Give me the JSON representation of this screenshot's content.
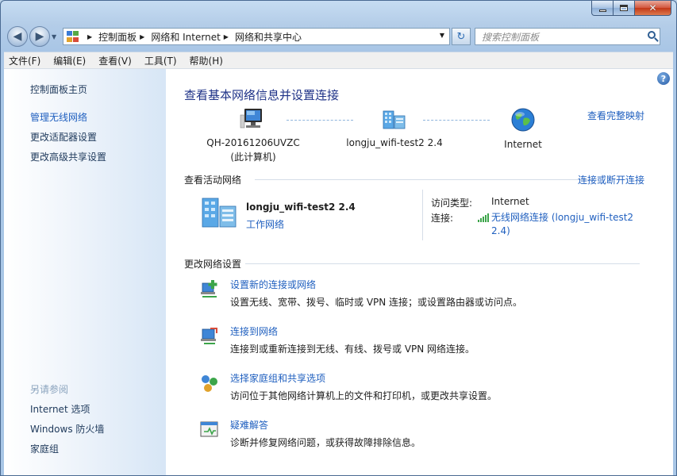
{
  "window": {
    "caption_buttons": [
      "minimize",
      "maximize",
      "close"
    ]
  },
  "nav": {
    "breadcrumb": [
      "控制面板",
      "网络和 Internet",
      "网络和共享中心"
    ],
    "search_placeholder": "搜索控制面板"
  },
  "menu": [
    "文件(F)",
    "编辑(E)",
    "查看(V)",
    "工具(T)",
    "帮助(H)"
  ],
  "sidebar": {
    "home": "控制面板主页",
    "tasks": [
      "管理无线网络",
      "更改适配器设置",
      "更改高级共享设置"
    ],
    "see_also_header": "另请参阅",
    "see_also": [
      "Internet 选项",
      "Windows 防火墙",
      "家庭组"
    ]
  },
  "main": {
    "title": "查看基本网络信息并设置连接",
    "full_map_link": "查看完整映射",
    "map": {
      "computer_line1": "QH-20161206UVZC",
      "computer_line2": "(此计算机)",
      "network": "longju_wifi-test2  2.4",
      "internet": "Internet"
    },
    "active_networks_header": "查看活动网络",
    "connect_disconnect_link": "连接或断开连接",
    "active_network": {
      "name": "longju_wifi-test2  2.4",
      "type": "工作网络",
      "access_type_label": "访问类型:",
      "access_type_value": "Internet",
      "connection_label": "连接:",
      "connection_value": "无线网络连接 (longju_wifi-test2 2.4)"
    },
    "change_settings_header": "更改网络设置",
    "tasks": [
      {
        "icon": "new-connection-icon",
        "title": "设置新的连接或网络",
        "desc": "设置无线、宽带、拨号、临时或 VPN 连接；或设置路由器或访问点。"
      },
      {
        "icon": "connect-network-icon",
        "title": "连接到网络",
        "desc": "连接到或重新连接到无线、有线、拨号或 VPN 网络连接。"
      },
      {
        "icon": "homegroup-icon",
        "title": "选择家庭组和共享选项",
        "desc": "访问位于其他网络计算机上的文件和打印机，或更改共享设置。"
      },
      {
        "icon": "troubleshoot-icon",
        "title": "疑难解答",
        "desc": "诊断并修复网络问题，或获得故障排除信息。"
      }
    ]
  },
  "colors": {
    "link": "#1f5fbf",
    "title": "#1e3287",
    "signal": "#3ca54a"
  }
}
